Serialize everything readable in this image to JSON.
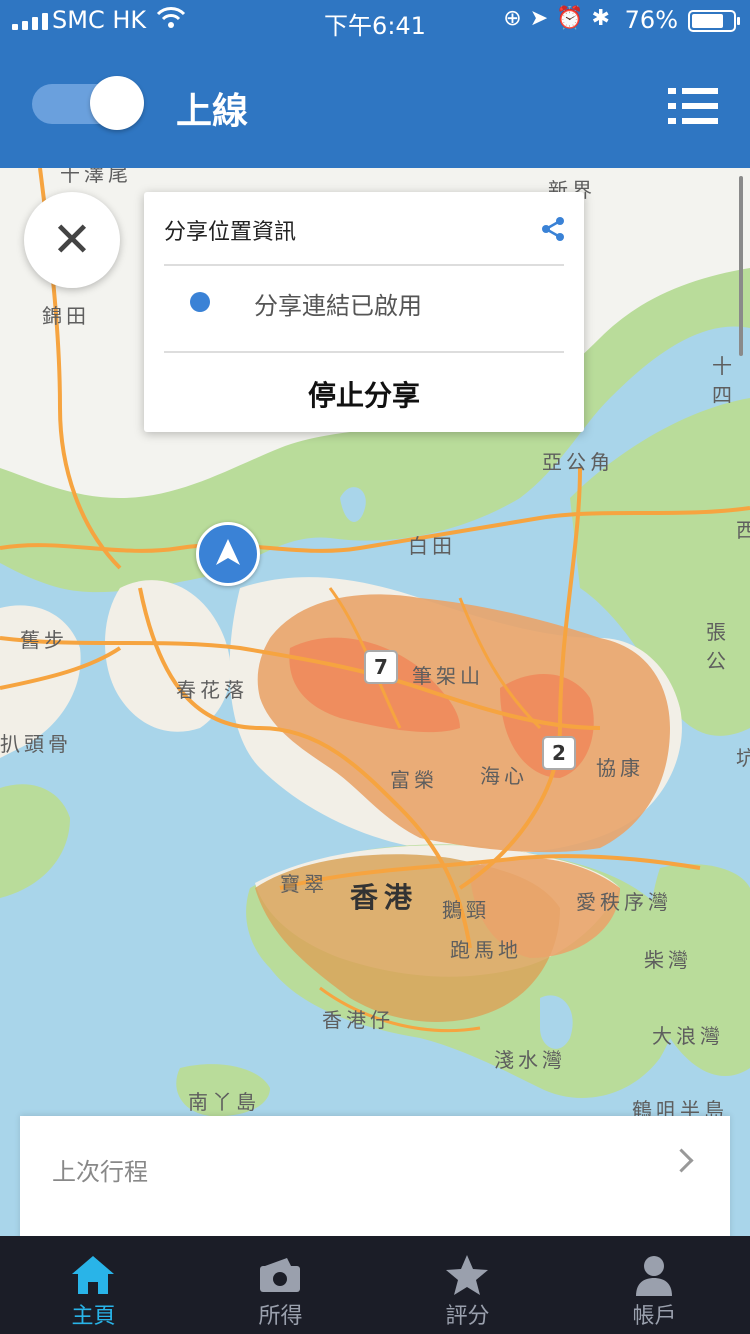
{
  "status_bar": {
    "carrier": "SMC HK",
    "time": "下午6:41",
    "battery_percent_text": "76%",
    "battery_level": 0.76
  },
  "header": {
    "online_toggle_on": true,
    "title": "上線",
    "menu_icon": "list-menu-icon"
  },
  "map": {
    "labels": [
      "新界",
      "錦田",
      "亞公角",
      "白田",
      "舊步",
      "春花落",
      "筆架山",
      "富榮",
      "海心",
      "協康",
      "扒頭骨",
      "香港",
      "寶翠",
      "鵝頸",
      "愛秩序灣",
      "跑馬地",
      "柴灣",
      "香港仔",
      "淺水灣",
      "大浪灣",
      "南丫島",
      "鶴咀半島",
      "張公",
      "坑",
      "十四",
      "西",
      "千澤尾"
    ],
    "route_badges": [
      "7",
      "2"
    ],
    "heat_colors": [
      "#ef8f5c",
      "#e9a66a",
      "#d9a35a"
    ]
  },
  "share_popup": {
    "title": "分享位置資訊",
    "status": "分享連結已啟用",
    "stop_button": "停止分享",
    "accent_color": "#3a82d6"
  },
  "last_trip": {
    "label": "上次行程"
  },
  "tab_bar": {
    "tabs": [
      {
        "label": "主頁",
        "icon": "home-icon",
        "active": true
      },
      {
        "label": "所得",
        "icon": "wallet-icon",
        "active": false
      },
      {
        "label": "評分",
        "icon": "star-icon",
        "active": false
      },
      {
        "label": "帳戶",
        "icon": "person-icon",
        "active": false
      }
    ],
    "active_color": "#29b4e8"
  }
}
